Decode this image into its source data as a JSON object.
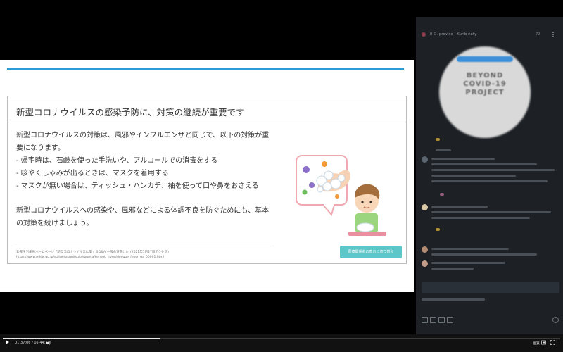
{
  "slide": {
    "title": "新型コロナウイルスの感染予防に、対策の継続が重要です",
    "body_lines": [
      "新型コロナウイルスの対策は、風邪やインフルエンザと同じで、以下の対策が重",
      "要になります。",
      "- 帰宅時は、石鹸を使った手洗いや、アルコールでの消毒をする",
      "- 咳やくしゃみが出るときは、マスクを着用する",
      "- マスクが無い場合は、ティッシュ・ハンカチ、袖を使って口や鼻をおさえる",
      "",
      "新型コロナウイルスへの感染や、風邪などによる体調不良を防ぐためにも、基本",
      "の対策を続けましょう。"
    ],
    "footnote_lines": [
      "1)厚生労働省ホームページ「新型コロナウイルスに関するQ&A(一般の方向け)」(2021年1月27日アクセス)",
      "https://www.mhlw.go.jp/stf/seisakunitsuite/bunya/kenkou_iryou/dengue_fever_qa_00001.html"
    ],
    "mode_button_label": "医療関係者の表示に切り替え",
    "accent_color": "#2e9bd6",
    "button_color": "#5cc6c8"
  },
  "chat": {
    "title": "Il-D. proviso | Kurib noty",
    "viewer_count": "72",
    "banner_text": [
      "BEYOND",
      "COVID-19",
      "PROJECT"
    ],
    "background_color": "#1d2126"
  },
  "player": {
    "current_time": "01:37:06",
    "duration": "05:44:27",
    "progress_fraction": 0.282,
    "quality_label": "画質"
  }
}
